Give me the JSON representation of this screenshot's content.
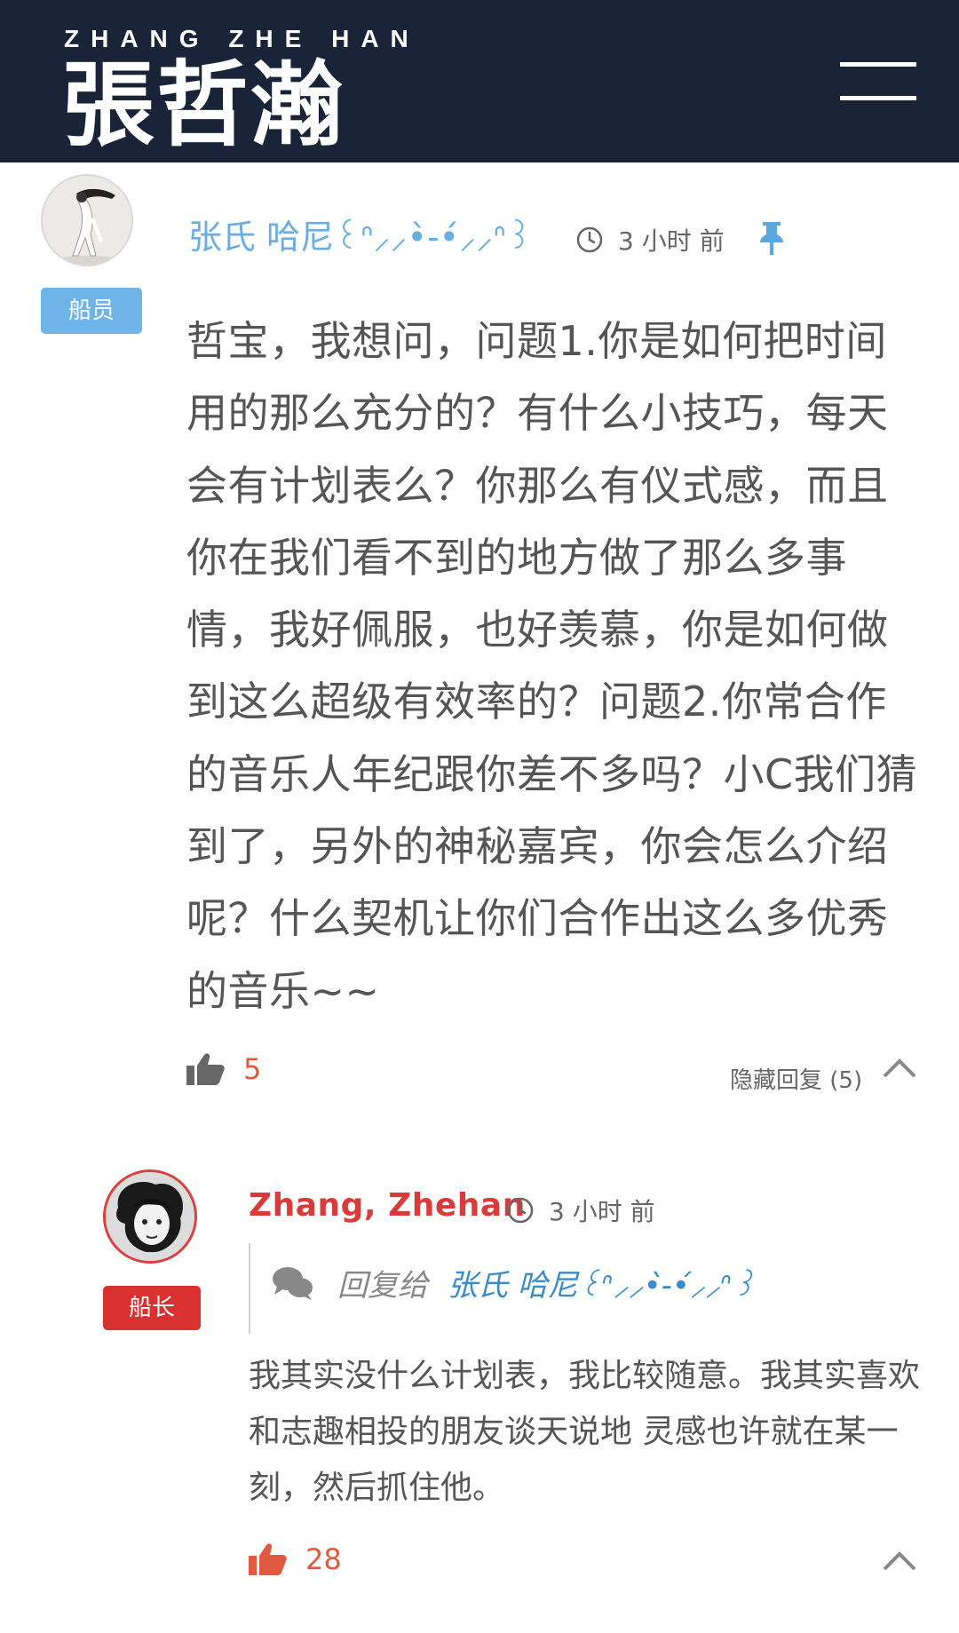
{
  "header": {
    "logo_en": "ZHANG ZHE HAN",
    "logo_cn": "張哲瀚",
    "menu_icon": "hamburger-menu-icon"
  },
  "comment": {
    "author": "张氏 哈尼꒰ᐢ⸝⸝•̀-•́⸝⸝ᐢ꒱",
    "role_badge": "船员",
    "time": "3 小时 前",
    "pinned_icon": "pin-icon",
    "text": "哲宝，我想问，问题1.你是如何把时间用的那么充分的？有什么小技巧，每天会有计划表么？你那么有仪式感，而且你在我们看不到的地方做了那么多事情，我好佩服，也好羡慕，你是如何做到这么超级有效率的？问题2.你常合作的音乐人年纪跟你差不多吗？小C我们猜到了，另外的神秘嘉宾，你会怎么介绍呢？什么契机让你们合作出这么多优秀的音乐~~",
    "likes": "5",
    "hide_replies": "隐藏回复 (5)"
  },
  "reply": {
    "author": "Zhang, Zhehan",
    "role_badge": "船长",
    "time": "3 小时 前",
    "reply_to_label": "回复给",
    "reply_to_name": "张氏 哈尼꒰ᐢ⸝⸝•̀-•́⸝⸝ᐢ꒱",
    "text": "我其实没什么计划表，我比较随意。我其实喜欢和志趣相投的朋友谈天说地 灵感也许就在某一刻，然后抓住他。",
    "likes": "28"
  },
  "colors": {
    "header_bg": "#1a2438",
    "member_blue": "#6fb4e8",
    "captain_red": "#d93030",
    "like_red": "#e05a42"
  }
}
